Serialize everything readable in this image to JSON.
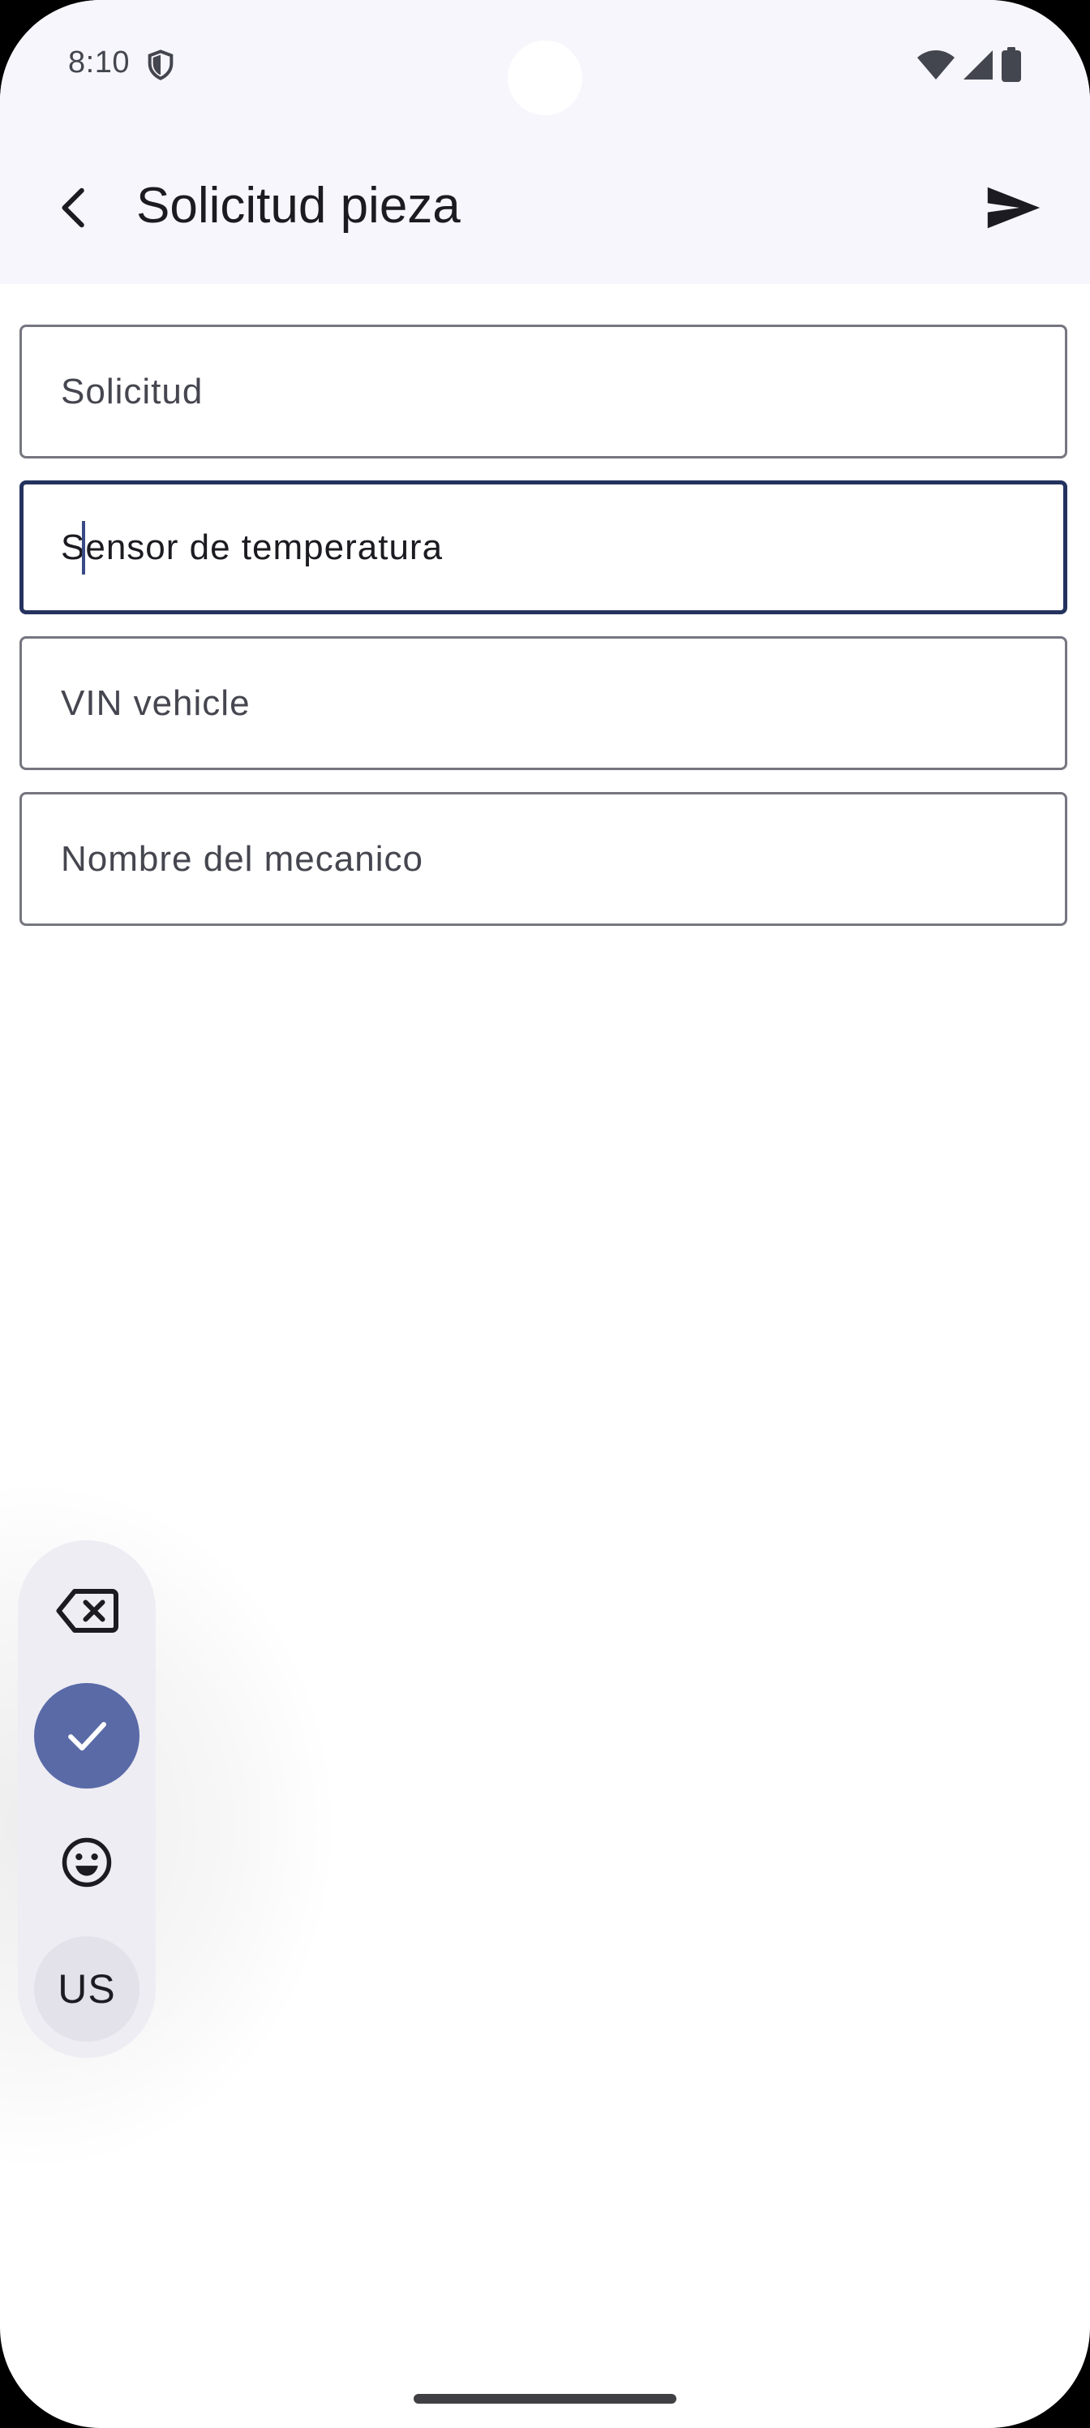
{
  "status_bar": {
    "time": "8:10",
    "shield_icon": "shield-icon",
    "wifi_icon": "wifi-icon",
    "signal_icon": "cell-signal-icon",
    "battery_icon": "battery-icon"
  },
  "app_bar": {
    "back_icon": "arrow-back-icon",
    "title": "Solicitud pieza",
    "send_icon": "send-icon"
  },
  "form": {
    "fields": [
      {
        "label": "Solicitud",
        "focused": false
      },
      {
        "value": "Sensor de temperatura",
        "focused": true
      },
      {
        "label": "VIN vehicle",
        "focused": false
      },
      {
        "label": "Nombre del mecanico",
        "focused": false
      }
    ]
  },
  "keyboard_toolbar": {
    "backspace_icon": "backspace-icon",
    "confirm_icon": "check-icon",
    "emoji_icon": "emoji-icon",
    "language_label": "US"
  },
  "colors": {
    "top_surface": "#f7f6fc",
    "focus_border": "#24325e",
    "accent": "#5a6aa7",
    "text_primary": "#1b1b21"
  }
}
